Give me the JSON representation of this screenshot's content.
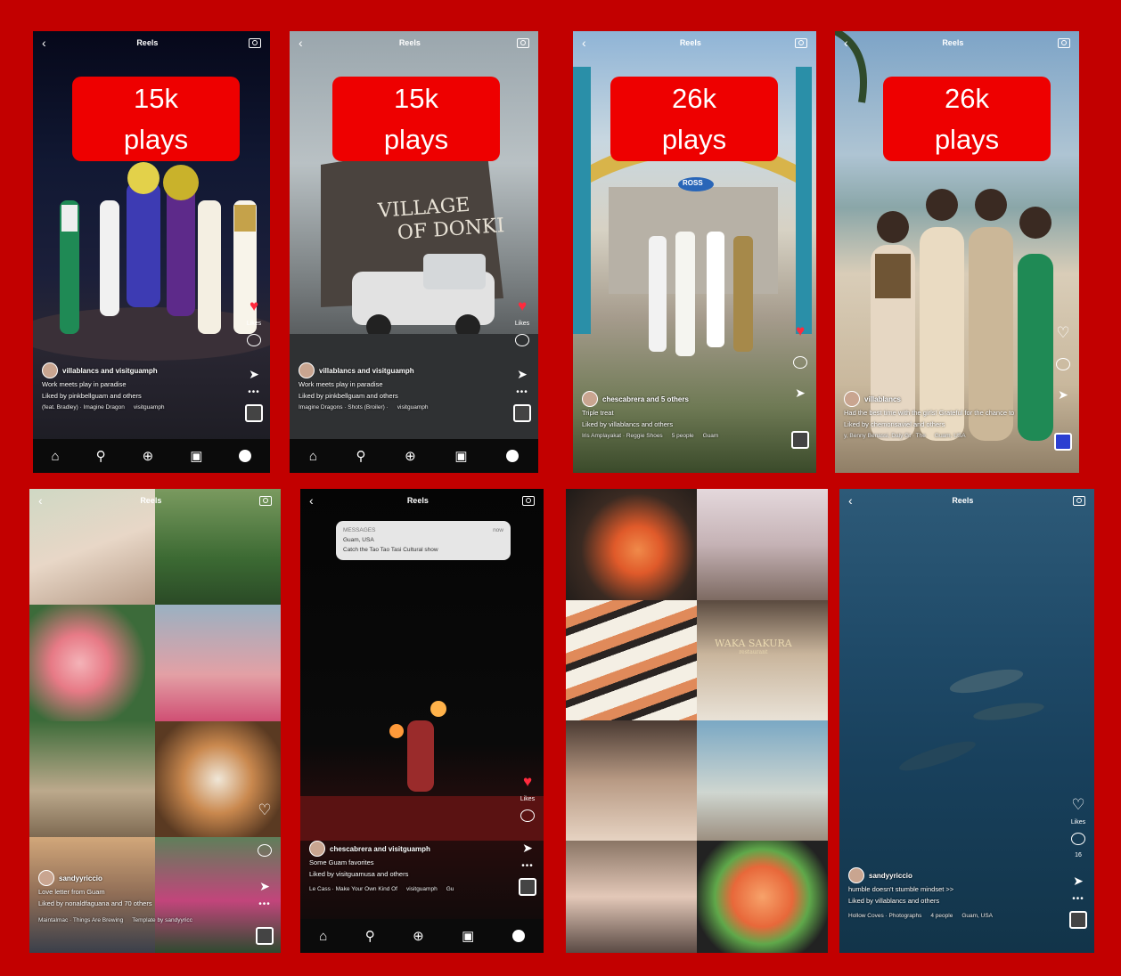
{
  "badges": [
    {
      "line1": "15k",
      "line2": "plays"
    },
    {
      "line1": "15k",
      "line2": "plays"
    },
    {
      "line1": "26k",
      "line2": "plays"
    },
    {
      "line1": "26k",
      "line2": "plays"
    }
  ],
  "reels_title": "Reels",
  "likes_label": "Likes",
  "reels": [
    {
      "user": "villablancs and visitguamph",
      "caption": "Work meets play in paradise",
      "liked_by": "Liked by pinkbellguam and others",
      "audio": "(feat. Bradley) · Imagine Dragon",
      "tag": "visitguamph"
    },
    {
      "user": "villablancs and visitguamph",
      "caption": "Work meets play in paradise",
      "liked_by": "Liked by pinkbellguam and others",
      "audio": "Imagine Dragons · Shots (Broiler) ·",
      "tag": "visitguamph",
      "sign_line1": "VILLAGE",
      "sign_line2": "OF DONKI"
    },
    {
      "user": "chescabrera and 5 others",
      "caption": "Triple treat",
      "liked_by": "Liked by villablancs and others",
      "audio": "Iris Amplayakat · Reggie Shoes",
      "people": "5 people",
      "location": "Guam",
      "store_sign": "ROSS"
    },
    {
      "user": "villablancs",
      "caption": "Had the best time with the girls! Grateful for the chance to",
      "liked_by": "Liked by chemonsaviel and others",
      "audio": "y, Benny Benassi, Daly Gt · The",
      "location": "Guam, USA"
    },
    {
      "user": "sandyyriccio",
      "caption": "Love letter from Guam",
      "liked_by": "Liked by nonaldfaguana and 70 others",
      "audio": "Maintalmac · Things Are Brewing",
      "template": "Template by sandyyricc"
    },
    {
      "user": "chescabrera and visitguamph",
      "caption": "Some Guam favorites",
      "liked_by": "Liked by visitguamusa and others",
      "audio": "Le Cass · Make Your Own Kind Of",
      "tag": "visitguamph",
      "location": "Gu",
      "notification": {
        "app": "MESSAGES",
        "time": "now",
        "title": "Guam, USA",
        "body": "Catch the Tao Tao Tasi Cultural show"
      }
    },
    {
      "restaurant": "WAKA SAKURA",
      "restaurant_sub": "restaurant"
    },
    {
      "user": "sandyyriccio",
      "caption": "humble doesn't stumble mindset >>",
      "liked_by": "Liked by villablancs and others",
      "audio": "Hollow Coves · Photographs",
      "people": "4 people",
      "location": "Guam, USA",
      "comments": "16"
    }
  ]
}
